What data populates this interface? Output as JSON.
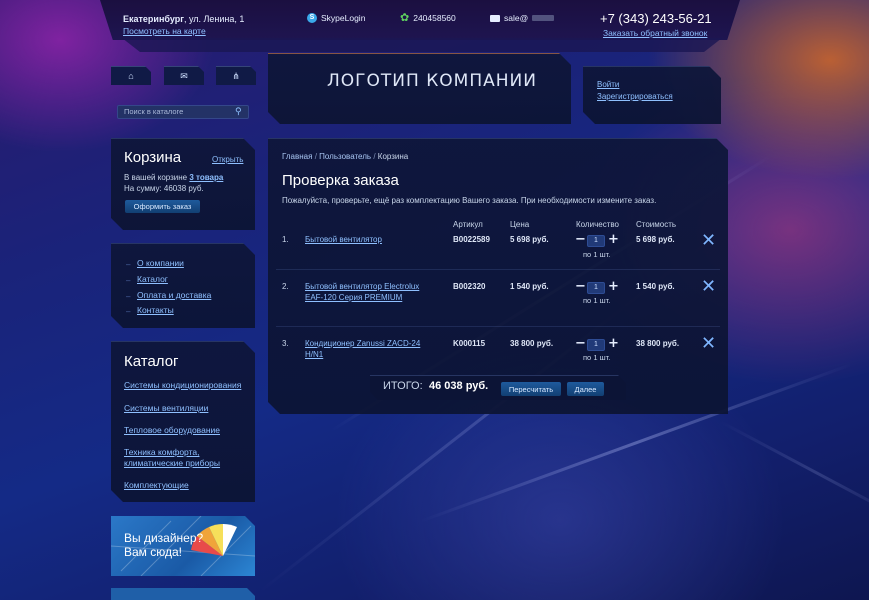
{
  "header": {
    "city": "Екатеринбург",
    "address": ", ул. Ленина, 1",
    "map_link": "Посмотреть на карте",
    "skype": "SkypeLogin",
    "icq": "240458560",
    "email": "sale@",
    "phone": "+7 (343) 243-56-21",
    "callback_link": "Заказать обратный звонок"
  },
  "logo": {
    "text": "ЛОГОТИП КОМПАНИИ"
  },
  "auth": {
    "login": "Войти",
    "register": "Зарегистрироваться"
  },
  "search": {
    "placeholder": "Поиск в каталоге"
  },
  "cart_widget": {
    "title": "Корзина",
    "open_link": "Открыть",
    "line1_prefix": "В вашей корзине ",
    "line1_count": "3 товара",
    "line2": "На сумму: 46038 руб.",
    "button": "Оформить заказ"
  },
  "menu": {
    "items": [
      "О компании",
      "Каталог",
      "Оплата и доставка",
      "Контакты"
    ]
  },
  "catalog": {
    "title": "Каталог",
    "items": [
      "Системы кондиционирования",
      "Системы вентиляции",
      "Тепловое оборудование",
      "Техника комфорта,",
      "климатические приборы",
      "Комплектующие"
    ]
  },
  "banner": {
    "line1": "Вы дизайнер?",
    "line2": "Вам сюда!"
  },
  "breadcrumb": {
    "home": "Главная",
    "sep1": "/",
    "user": "Пользователь",
    "sep2": "/",
    "current": "Корзина"
  },
  "page": {
    "title": "Проверка заказа",
    "subtitle": "Пожалуйста, проверьте, ещё раз комплектацию Вашего заказа. При необходимости измените заказ."
  },
  "table": {
    "headers": {
      "article": "Артикул",
      "price": "Цена",
      "quantity": "Количество",
      "cost": "Стоимость"
    },
    "rows": [
      {
        "num": "1.",
        "name1": "Бытовой вентилятор",
        "name2": "",
        "article": "B0022589",
        "price": "5 698 руб.",
        "qty": "1",
        "per": "по 1 шт.",
        "cost": "5 698 руб."
      },
      {
        "num": "2.",
        "name1": "Бытовой вентилятор Electrolux",
        "name2": "EAF-120 Серия PREMIUM",
        "article": "B002320",
        "price": "1 540 руб.",
        "qty": "1",
        "per": "по 1 шт.",
        "cost": "1 540 руб."
      },
      {
        "num": "3.",
        "name1": "Кондиционер Zanussi ZACD-24",
        "name2": "H/N1",
        "article": "K000115",
        "price": "38 800 руб.",
        "qty": "1",
        "per": "по 1 шт.",
        "cost": "38 800 руб."
      }
    ]
  },
  "total": {
    "label": "ИТОГО:",
    "amount": "46 038 руб.",
    "recalc_button": "Пересчитать",
    "next_button": "Далее"
  },
  "colors": {
    "link": "#8fc0ff",
    "button": "#1e5a9c",
    "panel": "#0e163a",
    "close": "#7fb6ff"
  }
}
